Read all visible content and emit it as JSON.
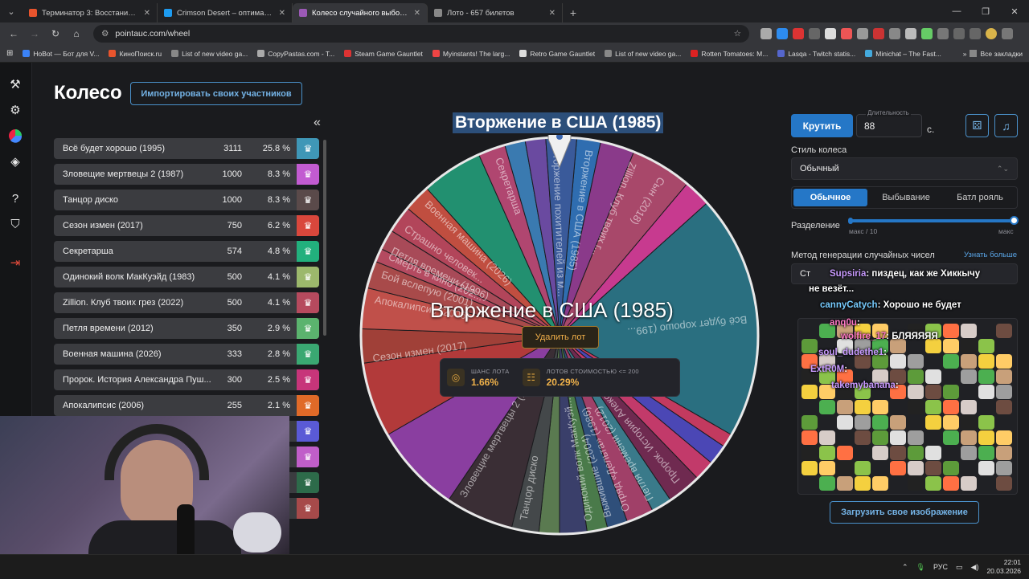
{
  "browser": {
    "tabs": [
      {
        "title": "Терминатор 3: Восстание маш",
        "color": "#e8542d",
        "active": false
      },
      {
        "title": "Crimson Desert – оптимальные",
        "color": "#1d9bf0",
        "active": false
      },
      {
        "title": "Колесо случайного выбора – ",
        "color": "#9b59b6",
        "active": true
      },
      {
        "title": "Лото - 657 билетов",
        "color": "#888888",
        "active": false
      }
    ],
    "url": "pointauc.com/wheel",
    "bookmarks": [
      "HoBot — Бот для V...",
      "КиноПоиск.ru",
      "List of new video ga...",
      "CopyPastas.com - T...",
      "Steam Game Gauntlet",
      "Myinstants! The larg...",
      "Retro Game Gauntlet",
      "List of new video ga...",
      "Rotten Tomatoes: M...",
      "Lasqa - Twitch statis...",
      "Minichat – The Fast..."
    ],
    "bookmarks_all": "Все закладки"
  },
  "page": {
    "title": "Колесо",
    "import_button": "Импортировать своих участников",
    "collapse_icon": "«"
  },
  "lots": [
    {
      "name": "Всё будет хорошо (1995)",
      "amount": "3111",
      "percent": "25.8 %",
      "color": "#3f97b7"
    },
    {
      "name": "Зловещие мертвецы 2 (1987)",
      "amount": "1000",
      "percent": "8.3 %",
      "color": "#c25bd1"
    },
    {
      "name": "Танцор диско",
      "amount": "1000",
      "percent": "8.3 %",
      "color": "#5a4a4a"
    },
    {
      "name": "Сезон измен (2017)",
      "amount": "750",
      "percent": "6.2 %",
      "color": "#d9473c"
    },
    {
      "name": "Секретарша",
      "amount": "574",
      "percent": "4.8 %",
      "color": "#22b07d"
    },
    {
      "name": "Одинокий волк МакКуэйд (1983)",
      "amount": "500",
      "percent": "4.1 %",
      "color": "#9cb86c"
    },
    {
      "name": "Zillion. Клуб твоих грез (2022)",
      "amount": "500",
      "percent": "4.1 %",
      "color": "#b64a5e"
    },
    {
      "name": "Петля времени (2012)",
      "amount": "350",
      "percent": "2.9 %",
      "color": "#5bb36e"
    },
    {
      "name": "Военная машина (2026)",
      "amount": "333",
      "percent": "2.8 %",
      "color": "#3aa872"
    },
    {
      "name": "Пророк. История Александра Пуш...",
      "amount": "300",
      "percent": "2.5 %",
      "color": "#c7357a"
    },
    {
      "name": "Апокалипсис (2006)",
      "amount": "255",
      "percent": "2.1 %",
      "color": "#e06a28"
    },
    {
      "name": "",
      "amount": "",
      "percent": "",
      "color": "#5a5ad6"
    },
    {
      "name": "",
      "amount": "",
      "percent": "",
      "color": "#c05ec9"
    },
    {
      "name": "",
      "amount": "",
      "percent": "",
      "color": "#2d6b4a"
    },
    {
      "name": "",
      "amount": "",
      "percent": "",
      "color": "#a64a4a"
    }
  ],
  "wheel": {
    "winner_title": "Вторжение в США (1985)",
    "center_name": "Вторжение в США (1985)",
    "delete_button": "Удалить лот",
    "stat_chance_label": "ШАНС ЛОТА",
    "stat_chance_value": "1.66%",
    "stat_cost_label": "ЛОТОВ СТОИМОСТЬЮ <= 200",
    "stat_cost_value": "20.29%",
    "slice_labels": [
      "Всё будет хорошо (199...",
      "Сын (2018)",
      "Zillion. Клуб твоих г...",
      "Вторжение в США (1985)",
      "Вторжение похитителей из м...",
      "Секретарша",
      "Военная машина (2026)",
      "Страшно человек...",
      "Петля времени (1996)",
      "Сезон измен (2017)",
      "Зловещие мертвецы 2 (...",
      "Танцор диско",
      "Одинокий волк МакКуэй...",
      "Выжившие (2004)",
      "Отряд «Дельта» (1986)",
      "Петля времени (2012)",
      "Пророк. История Алекс...",
      "Апокалипсис (2006)",
      "Смерть в кино (202...",
      "Бой вслепую (2001)"
    ]
  },
  "controls": {
    "spin_button": "Крутить",
    "duration_label": "Длительность",
    "duration_value": "88",
    "duration_unit": "с.",
    "dice_icon": "⚄",
    "music_icon": "♫",
    "style_label": "Стиль колеса",
    "style_value": "Обычный",
    "modes": [
      "Обычное",
      "Выбывание",
      "Батл рояль"
    ],
    "split_label": "Разделение",
    "split_min": "макс / 10",
    "split_max": "макс",
    "rng_label": "Метод генерации случайных чисел",
    "rng_link": "Узнать больше",
    "rng_value": "Ст",
    "upload_button": "Загрузить свое изображение"
  },
  "chat": [
    {
      "user": "Supsiria",
      "text": ": пиздец, как же Хиккычу",
      "cont": "не везёт..."
    },
    {
      "user": "cannyCatych",
      "text": ": Хорошо не будет"
    },
    {
      "user": "anq0u",
      "text": ":"
    },
    {
      "user": "wolfire_17",
      "text": ": БЛЯЯЯЯЯ"
    },
    {
      "user": "soul_dudethe1",
      "text": ":"
    },
    {
      "user": "ExtR0M",
      "text": ":"
    },
    {
      "user": "takemybanana",
      "text": ":"
    }
  ],
  "taskbar": {
    "lang": "РУС",
    "time": "22:01",
    "date": "20.03.2026"
  }
}
